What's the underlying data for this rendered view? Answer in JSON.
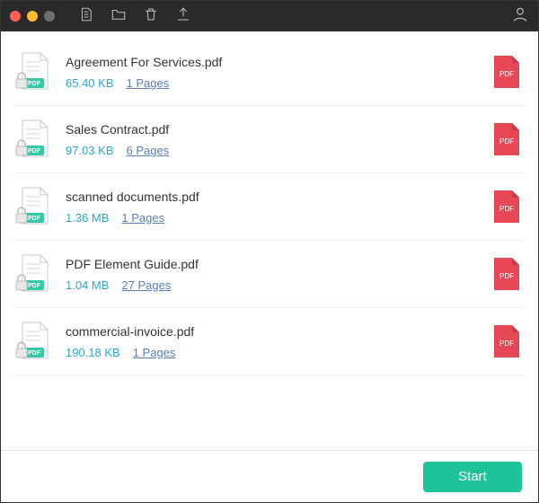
{
  "footer": {
    "start_label": "Start"
  },
  "pdf_badge": "PDF",
  "files": [
    {
      "name": "Agreement For Services.pdf",
      "size": "65.40 KB",
      "pages": "1 Pages"
    },
    {
      "name": "Sales Contract.pdf",
      "size": "97.03 KB",
      "pages": "6 Pages"
    },
    {
      "name": "scanned documents.pdf",
      "size": "1.36 MB",
      "pages": "1 Pages"
    },
    {
      "name": "PDF Element Guide.pdf",
      "size": "1.04 MB",
      "pages": "27 Pages"
    },
    {
      "name": "commercial-invoice.pdf",
      "size": "190.18 KB",
      "pages": "1 Pages"
    }
  ]
}
